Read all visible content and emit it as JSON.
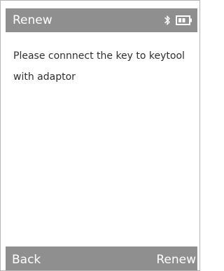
{
  "header": {
    "title": "Renew",
    "status_icons": [
      "bluetooth-icon",
      "battery-icon"
    ]
  },
  "content": {
    "message_line1": "Please connnect the key to keytool",
    "message_line2": "with adaptor"
  },
  "softkeys": {
    "left_label": "Back",
    "right_label": "Renew"
  },
  "colors": {
    "bar_background": "#8f8f8f",
    "bar_text": "#ffffff",
    "body_text": "#2e2e2e",
    "screen_background": "#ffffff"
  }
}
